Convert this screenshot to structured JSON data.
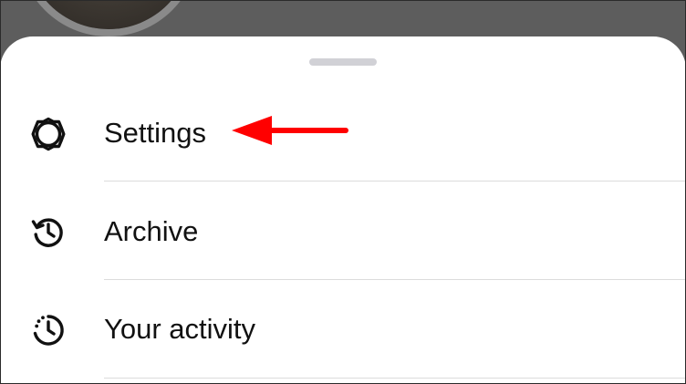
{
  "menu": {
    "items": [
      {
        "label": "Settings",
        "icon": "settings-gear-icon"
      },
      {
        "label": "Archive",
        "icon": "archive-history-icon"
      },
      {
        "label": "Your activity",
        "icon": "activity-clock-icon"
      }
    ]
  },
  "colors": {
    "overlay": "#5d5d5d",
    "sheet": "#ffffff",
    "handle": "#d1d1d6",
    "text": "#111111",
    "divider": "#dcdcdc",
    "annotation": "#ff0000"
  }
}
